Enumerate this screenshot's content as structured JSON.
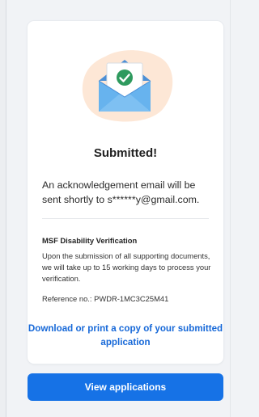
{
  "status": {
    "title": "Submitted!",
    "acknowledgement": "An acknowledgement email will be sent shortly to s******y@gmail.com."
  },
  "verification": {
    "title": "MSF Disability Verification",
    "body": "Upon the submission of all supporting documents, we will take up to 15 working days to process your verification.",
    "reference": "Reference no.: PWDR-1MC3C25M41"
  },
  "actions": {
    "download_link": "Download or print a copy of your submitted application",
    "view_applications": "View applications"
  },
  "colors": {
    "accent": "#1672e6",
    "link": "#1668d8",
    "success": "#2e9a5e",
    "envelope": "#67b3ee",
    "blob": "#fde7d6"
  },
  "icons": {
    "illustration": "envelope-checkmark-icon"
  }
}
